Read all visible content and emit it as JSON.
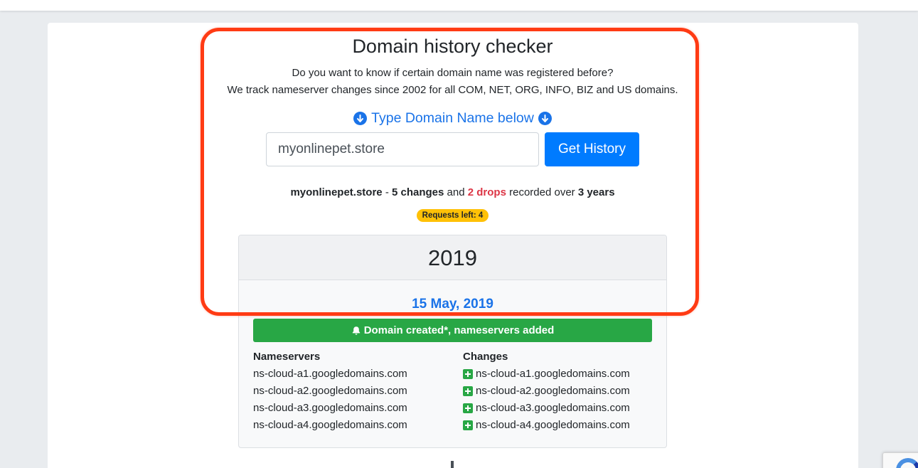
{
  "page": {
    "title": "Domain history checker",
    "intro_line1": "Do you want to know if certain domain name was registered before?",
    "intro_line2": "We track nameserver changes since 2002 for all COM, NET, ORG, INFO, BIZ and US domains.",
    "prompt": "Type Domain Name below",
    "prompt_icon": "circle-arrow-down-icon"
  },
  "search": {
    "value": "myonlinepet.store",
    "button_label": "Get History"
  },
  "summary": {
    "domain": "myonlinepet.store",
    "sep1": " - ",
    "changes": "5 changes",
    "and": " and ",
    "drops": "2 drops",
    "recorded": " recorded over ",
    "years": "3 years"
  },
  "badge": {
    "label": "Requests left: 4"
  },
  "history": {
    "year": "2019",
    "date": "15 May, 2019",
    "event": "Domain created*, nameservers added",
    "event_icon": "bell-icon",
    "nameservers_header": "Nameservers",
    "changes_header": "Changes",
    "nameservers": [
      "ns-cloud-a1.googledomains.com",
      "ns-cloud-a2.googledomains.com",
      "ns-cloud-a3.googledomains.com",
      "ns-cloud-a4.googledomains.com"
    ],
    "changes": [
      "ns-cloud-a1.googledomains.com",
      "ns-cloud-a2.googledomains.com",
      "ns-cloud-a3.googledomains.com",
      "ns-cloud-a4.googledomains.com"
    ],
    "change_icon": "plus-square-icon"
  },
  "colors": {
    "accent": "#1a73e8",
    "button": "#007bff",
    "success": "#28a745",
    "danger": "#dc3545",
    "badge": "#ffc107",
    "highlight": "#ff3b14"
  }
}
